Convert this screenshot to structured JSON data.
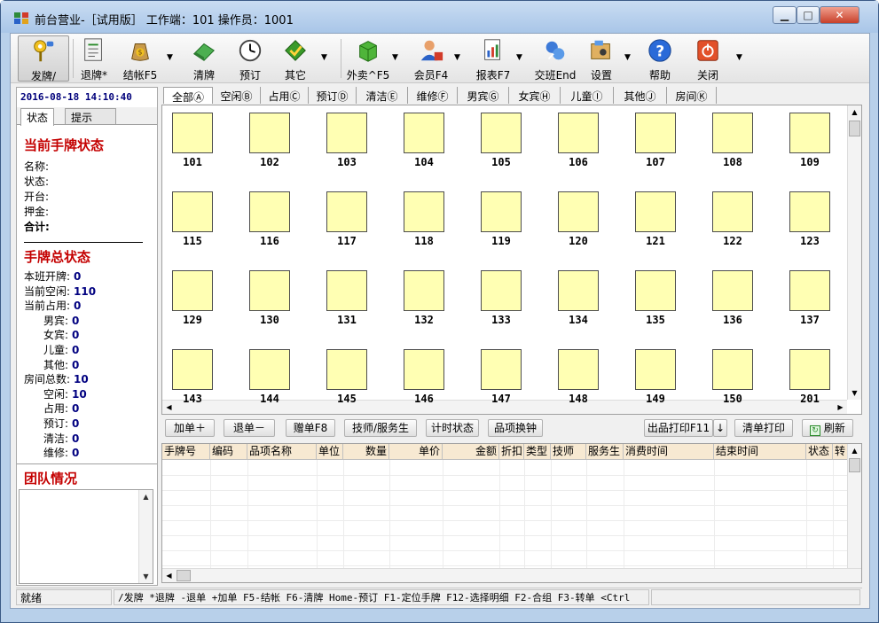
{
  "window": {
    "title": "前台营业-［试用版］ 工作端：101 操作员：1001"
  },
  "toolbar": [
    {
      "id": "issue",
      "label": "发牌/",
      "icon": "keys-icon"
    },
    {
      "id": "return",
      "label": "退牌*",
      "icon": "receipt-icon"
    },
    {
      "id": "checkout",
      "label": "结帐F5",
      "icon": "money-bag-icon"
    },
    {
      "id": "clear",
      "label": "清牌",
      "icon": "eraser-icon"
    },
    {
      "id": "reserve",
      "label": "预订",
      "icon": "clock-icon"
    },
    {
      "id": "other",
      "label": "其它",
      "icon": "checkmark-icon"
    },
    {
      "id": "takeout",
      "label": "外卖^F5",
      "icon": "cube-icon"
    },
    {
      "id": "member",
      "label": "会员F4",
      "icon": "member-icon"
    },
    {
      "id": "report",
      "label": "报表F7",
      "icon": "report-icon"
    },
    {
      "id": "shift",
      "label": "交班End",
      "icon": "shift-icon"
    },
    {
      "id": "settings",
      "label": "设置",
      "icon": "settings-icon"
    },
    {
      "id": "help",
      "label": "帮助",
      "icon": "help-icon"
    },
    {
      "id": "close",
      "label": "关闭",
      "icon": "power-icon"
    }
  ],
  "sidebar": {
    "datetime": "2016-08-18 14:10:40",
    "tabs": [
      "状态",
      "提示"
    ],
    "current_title": "当前手牌状态",
    "current_fields": [
      "名称:",
      "状态:",
      "开台:",
      "押金:",
      "合计:"
    ],
    "total_title": "手牌总状态",
    "stats": [
      {
        "label": "本班开牌:",
        "value": "0"
      },
      {
        "label": "当前空闲:",
        "value": "110"
      },
      {
        "label": "当前占用:",
        "value": "0"
      },
      {
        "label": "男宾:",
        "value": "0"
      },
      {
        "label": "女宾:",
        "value": "0"
      },
      {
        "label": "儿童:",
        "value": "0"
      },
      {
        "label": "其他:",
        "value": "0"
      },
      {
        "label": "房间总数:",
        "value": "10"
      },
      {
        "label": "空闲:",
        "value": "10"
      },
      {
        "label": "占用:",
        "value": "0"
      },
      {
        "label": "预订:",
        "value": "0"
      },
      {
        "label": "清洁:",
        "value": "0"
      },
      {
        "label": "维修:",
        "value": "0"
      }
    ],
    "team_title": "团队情况"
  },
  "room_tabs": [
    "全部Ⓐ",
    "空闲Ⓑ",
    "占用Ⓒ",
    "预订Ⓓ",
    "清洁Ⓔ",
    "维修Ⓕ",
    "男宾Ⓖ",
    "女宾Ⓗ",
    "儿童Ⓘ",
    "其他Ⓙ",
    "房间Ⓚ"
  ],
  "rooms": [
    "101",
    "102",
    "103",
    "104",
    "105",
    "106",
    "107",
    "108",
    "109",
    "115",
    "116",
    "117",
    "118",
    "119",
    "120",
    "121",
    "122",
    "123",
    "129",
    "130",
    "131",
    "132",
    "133",
    "134",
    "135",
    "136",
    "137",
    "143",
    "144",
    "145",
    "146",
    "147",
    "148",
    "149",
    "150",
    "201"
  ],
  "order_buttons": {
    "add": "加单＋",
    "remove": "退单－",
    "gift": "赠单F8",
    "tech": "技师/服务生",
    "timer": "计时状态",
    "swap": "品项换钟",
    "print": "出品打印F11",
    "print_arrow": "↓",
    "clear_print": "清单打印",
    "refresh": "刷新"
  },
  "detail_columns": [
    "手牌号",
    "编码",
    "品项名称",
    "单位",
    "数量",
    "单价",
    "金额",
    "折扣",
    "类型",
    "技师",
    "服务生",
    "消费时间",
    "结束时间",
    "状态",
    "转"
  ],
  "statusbar": {
    "ready": "就绪",
    "shortcuts": "/发牌  *退牌  -退单  +加单 F5-结帐 F6-清牌 Home-预订 F1-定位手牌 F12-选择明细 F2-合组 F3-转单 <Ctrl"
  }
}
